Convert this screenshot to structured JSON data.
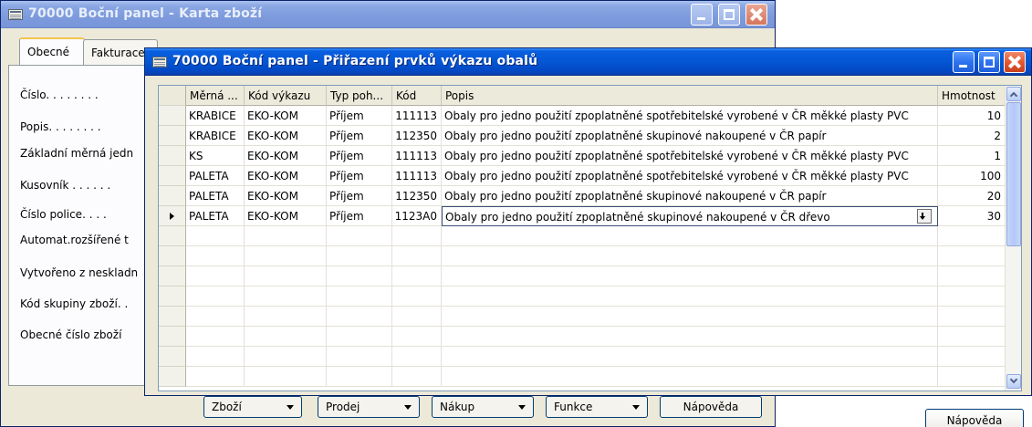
{
  "back_window": {
    "title": "70000 Boční panel - Karta zboží",
    "tabs": [
      "Obecné",
      "Fakturace"
    ],
    "fields": [
      "Číslo. . . . . . . .",
      "Popis. . . . . . . .",
      "Základní měrná jedn",
      "Kusovník . . . . . .",
      "Číslo police. . . .",
      "Automat.rozšířené t",
      "Vytvořeno z neskladn",
      "Kód skupiny zboží. .",
      "Obecné číslo zboží"
    ],
    "buttons": {
      "zbozi": "Zboží",
      "prodej": "Prodej",
      "nakup": "Nákup",
      "funkce": "Funkce",
      "napoveda": "Nápověda"
    }
  },
  "front_window": {
    "title": "70000 Boční panel - Přiřazení prvků výkazu obalů",
    "columns": [
      "Měrná ...",
      "Kód výkazu",
      "Typ poh...",
      "Kód",
      "Popis",
      "Hmotnost"
    ],
    "rows": [
      {
        "unit": "KRABICE",
        "report": "EKO-KOM",
        "type": "Příjem",
        "code": "111113",
        "desc": "Obaly pro jedno použití zpoplatněné spotřebitelské vyrobené v ČR měkké plasty PVC",
        "weight": "10"
      },
      {
        "unit": "KRABICE",
        "report": "EKO-KOM",
        "type": "Příjem",
        "code": "112350",
        "desc": "Obaly pro jedno použití zpoplatněné skupinové nakoupené v ČR papír",
        "weight": "2"
      },
      {
        "unit": "KS",
        "report": "EKO-KOM",
        "type": "Příjem",
        "code": "111113",
        "desc": "Obaly pro jedno použití zpoplatněné spotřebitelské vyrobené v ČR měkké plasty PVC",
        "weight": "1"
      },
      {
        "unit": "PALETA",
        "report": "EKO-KOM",
        "type": "Příjem",
        "code": "111113",
        "desc": "Obaly pro jedno použití zpoplatněné spotřebitelské vyrobené v ČR měkké plasty PVC",
        "weight": "100"
      },
      {
        "unit": "PALETA",
        "report": "EKO-KOM",
        "type": "Příjem",
        "code": "112350",
        "desc": "Obaly pro jedno použití zpoplatněné skupinové nakoupené v ČR papír",
        "weight": "20"
      },
      {
        "unit": "PALETA",
        "report": "EKO-KOM",
        "type": "Příjem",
        "code": "1123A0",
        "desc": "Obaly pro jedno použití zpoplatněné skupinové nakoupené v ČR dřevo",
        "weight": "30"
      }
    ],
    "help_label": "Nápověda"
  },
  "colors": {
    "title_active": "#0458d6",
    "title_inactive": "#7d9bdc",
    "window_face": "#ece9d8",
    "grid_header": "#ebeadb"
  }
}
